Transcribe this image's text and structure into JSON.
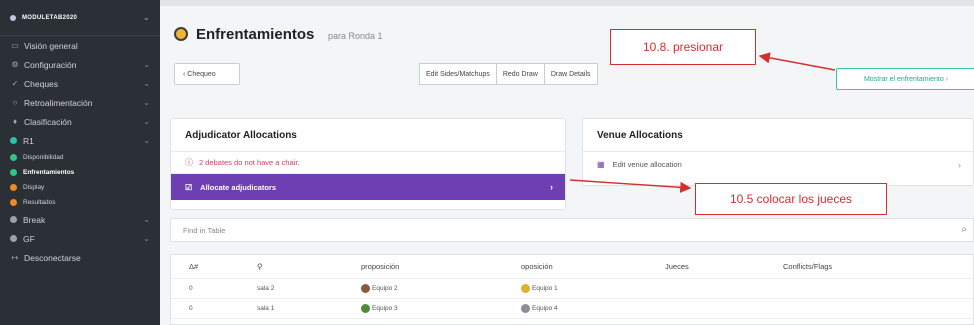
{
  "sidebar": {
    "brand": "MODULETAB2020",
    "items": [
      {
        "label": "Visión general",
        "icon": "monitor-icon",
        "glyph": "▭",
        "chev": false
      },
      {
        "label": "Configuración",
        "icon": "gear-icon",
        "glyph": "⚙",
        "chev": true
      },
      {
        "label": "Cheques",
        "icon": "check-icon",
        "glyph": "✓",
        "chev": true
      },
      {
        "label": "Retroalimentación",
        "icon": "feedback-icon",
        "glyph": "○",
        "chev": true
      },
      {
        "label": "Clasificación",
        "icon": "trophy-icon",
        "glyph": "♦",
        "chev": true
      },
      {
        "label": "R1",
        "icon": "round-dot-icon",
        "chev": true
      }
    ],
    "round_subitems": [
      {
        "label": "Disponibilidad",
        "dot": "green"
      },
      {
        "label": "Enfrentamientos",
        "dot": "green",
        "active": true
      },
      {
        "label": "Display",
        "dot": "orange"
      },
      {
        "label": "Resultados",
        "dot": "orange"
      }
    ],
    "bottom_items": [
      {
        "label": "Break",
        "dot": "grey"
      },
      {
        "label": "GF",
        "dot": "grey"
      },
      {
        "label": "Desconectarse",
        "icon": "logout-icon",
        "glyph": "↦"
      }
    ]
  },
  "header": {
    "title": "Enfrentamientos",
    "subtitle": "para Ronda 1"
  },
  "toolbar": {
    "back_label": "‹ Chequeo",
    "group": [
      "Edit Sides/Matchups",
      "Redo Draw",
      "Draw Details"
    ],
    "show_label": "Mostrar el enfrentamiento ›"
  },
  "adjudicator_card": {
    "title": "Adjudicator Allocations",
    "warning": "2 debates do not have a chair.",
    "allocate_label": "Allocate adjudicators"
  },
  "venue_card": {
    "title": "Venue Allocations",
    "edit_label": "Edit venue allocation"
  },
  "search": {
    "placeholder": "Find in Table"
  },
  "table": {
    "headers": [
      "Δ#",
      "⚲",
      "proposición",
      "oposición",
      "Jueces",
      "Conflicts/Flags"
    ],
    "rows": [
      {
        "n": "0",
        "venue": "sala 2",
        "prop": "Equipo 2",
        "opp": "Equipo 1",
        "prop_color": "#8a5a3c",
        "opp_color": "#e0b02a"
      },
      {
        "n": "0",
        "venue": "sala 1",
        "prop": "Equipo 3",
        "opp": "Equipo 4",
        "prop_color": "#4c8c3a",
        "opp_color": "#8a8f96"
      }
    ]
  },
  "annotations": {
    "step1": "10.8. presionar",
    "step2": "10.5 colocar los jueces",
    "color": "#d32f2f"
  }
}
